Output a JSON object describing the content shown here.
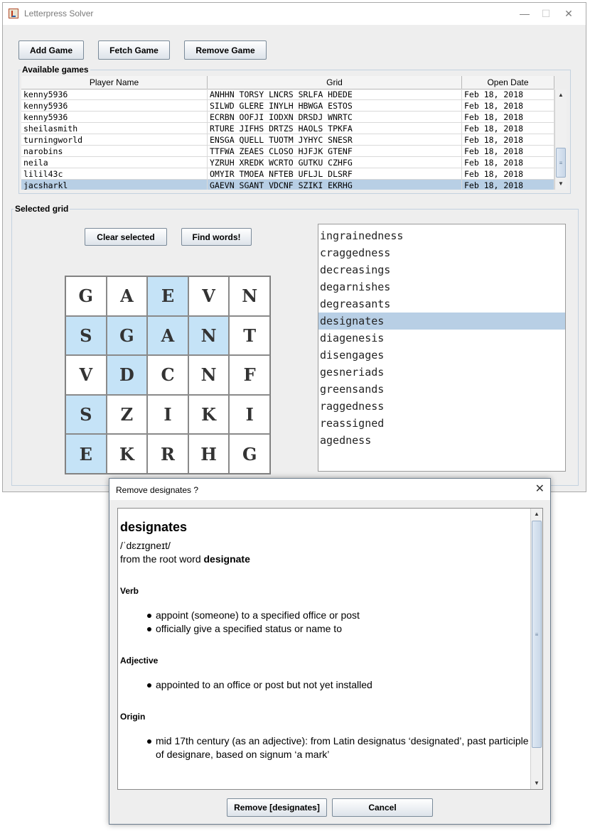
{
  "window": {
    "title": "Letterpress Solver",
    "controls": {
      "minimize": "—",
      "maximize": "☐",
      "close": "✕"
    }
  },
  "toolbar": {
    "add_game": "Add Game",
    "fetch_game": "Fetch Game",
    "remove_game": "Remove Game"
  },
  "games": {
    "legend": "Available games",
    "columns": [
      "Player Name",
      "Grid",
      "Open Date"
    ],
    "rows": [
      [
        "kenny5936",
        "ANHHN TORSY LNCRS SRLFA HDEDE",
        "Feb 18, 2018"
      ],
      [
        "kenny5936",
        "SILWD GLERE INYLH HBWGA ESTOS",
        "Feb 18, 2018"
      ],
      [
        "kenny5936",
        "ECRBN OOFJI IODXN DRSDJ WNRTC",
        "Feb 18, 2018"
      ],
      [
        "sheilasmith",
        "RTURE JIFHS DRTZS HAOLS TPKFA",
        "Feb 18, 2018"
      ],
      [
        "turningworld",
        "ENSGA QUELL TUOTM JYHYC SNESR",
        "Feb 18, 2018"
      ],
      [
        "narobins",
        "TTFWA ZEAES CLOSO HJFJK GTENF",
        "Feb 18, 2018"
      ],
      [
        "neila",
        "YZRUH XREDK WCRTO GUTKU CZHFG",
        "Feb 18, 2018"
      ],
      [
        "lilil43c",
        "OMYIR TMOEA NFTEB UFLJL DLSRF",
        "Feb 18, 2018"
      ],
      [
        "jacsharkl",
        "GAEVN SGANT VDCNF SZIKI EKRHG",
        "Feb 18, 2018"
      ]
    ],
    "selected_row": 8
  },
  "selected_grid": {
    "legend": "Selected grid",
    "clear_button": "Clear selected",
    "find_button": "Find words!",
    "highlight_color": "#c5e3f7",
    "cells": [
      [
        "G",
        "A",
        "E",
        "V",
        "N"
      ],
      [
        "S",
        "G",
        "A",
        "N",
        "T"
      ],
      [
        "V",
        "D",
        "C",
        "N",
        "F"
      ],
      [
        "S",
        "Z",
        "I",
        "K",
        "I"
      ],
      [
        "E",
        "K",
        "R",
        "H",
        "G"
      ]
    ],
    "highlighted": [
      [
        0,
        2
      ],
      [
        1,
        0
      ],
      [
        1,
        1
      ],
      [
        1,
        2
      ],
      [
        1,
        3
      ],
      [
        2,
        1
      ],
      [
        3,
        0
      ],
      [
        4,
        0
      ]
    ]
  },
  "words": {
    "items": [
      "ingrainedness",
      "craggedness",
      "decreasings",
      "degarnishes",
      "degreasants",
      "designates",
      "diagenesis",
      "disengages",
      "gesneriads",
      "greensands",
      "raggedness",
      "reassigned",
      "agedness"
    ],
    "selected": 5
  },
  "dialog": {
    "title": "Remove designates ?",
    "close": "✕",
    "word": "designates",
    "pronunciation": "/ˈdɛzɪɡneɪt/",
    "root_prefix": "from the root word",
    "root_word": "designate",
    "sections": [
      {
        "pos": "Verb",
        "defs": [
          "appoint (someone) to a specified office or post",
          "officially give a specified status or name to"
        ]
      },
      {
        "pos": "Adjective",
        "defs": [
          "appointed to an office or post but not yet installed"
        ]
      },
      {
        "pos": "Origin",
        "defs": [
          "mid 17th century (as an adjective): from Latin designatus ‘designated’, past participle of designare, based on signum ‘a mark’"
        ]
      }
    ],
    "remove_button": "Remove [designates]",
    "cancel_button": "Cancel"
  }
}
